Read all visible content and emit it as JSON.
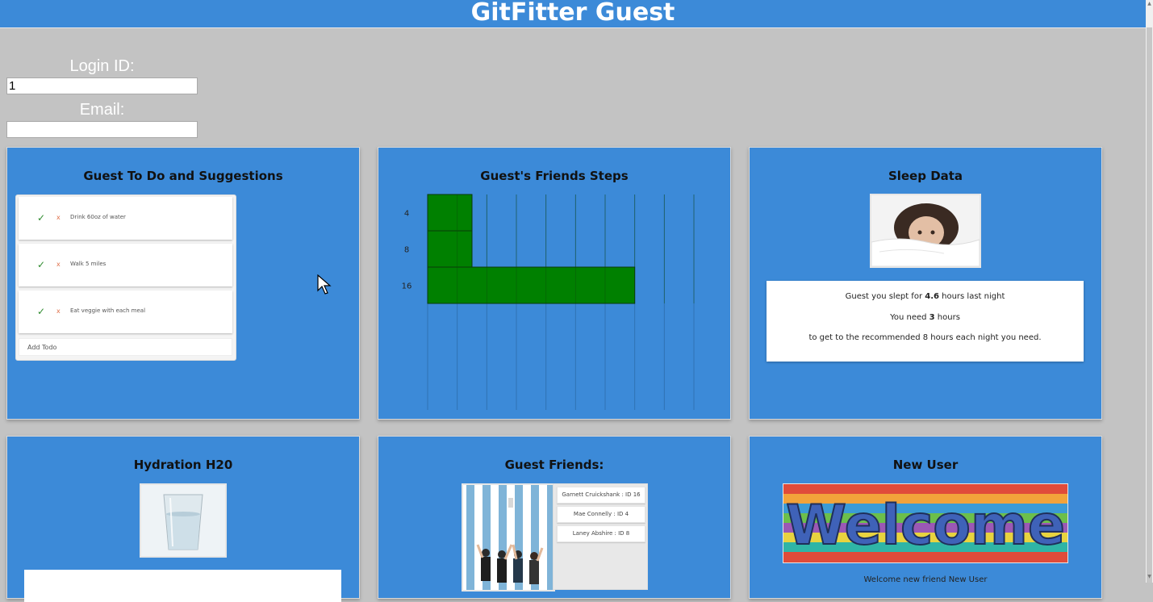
{
  "app": {
    "title": "GitFitter Guest"
  },
  "login": {
    "login_id_label": "Login ID:",
    "login_id_value": "1",
    "email_label": "Email:",
    "email_value": ""
  },
  "todo": {
    "title": "Guest To Do and Suggestions",
    "items": [
      {
        "check": "✓",
        "remove": "x",
        "text": "Drink 60oz of water"
      },
      {
        "check": "✓",
        "remove": "x",
        "text": "Walk 5 miles"
      },
      {
        "check": "✓",
        "remove": "x",
        "text": "Eat veggie with each meal"
      }
    ],
    "add_placeholder": "Add Todo"
  },
  "steps": {
    "title": "Guest's Friends Steps"
  },
  "chart_data": {
    "type": "bar",
    "orientation": "horizontal",
    "categories": [
      "4",
      "8",
      "16"
    ],
    "values": [
      1.5,
      1.5,
      7
    ],
    "xlim": [
      0,
      9
    ],
    "grid": true,
    "bar_color": "#008000"
  },
  "sleep": {
    "title": "Sleep Data",
    "line1_prefix": "Guest you slept for ",
    "hours_slept": "4.6",
    "line1_suffix": " hours last night",
    "line2_prefix": "You need ",
    "hours_needed": "3",
    "line2_suffix": " hours",
    "line3": "to get to the recommended 8 hours each night you need."
  },
  "hydration": {
    "title": "Hydration H20"
  },
  "friends": {
    "title": "Guest Friends:",
    "list": [
      "Garnett Cruickshank : ID 16",
      "Mae Connelly : ID 4",
      "Laney Abshire : ID 8"
    ]
  },
  "new_user": {
    "title": "New User",
    "welcome_sign": "Welcome",
    "caption": "Welcome new friend New User"
  },
  "colors": {
    "header": "#3c8ad8",
    "card": "#3c8ad8",
    "page_background": "#c3c3c3",
    "check": "#2e8b2e",
    "remove": "#e0704a"
  },
  "icons": {
    "check": "checkmark-icon",
    "remove": "close-icon",
    "cursor": "mouse-pointer-icon"
  }
}
